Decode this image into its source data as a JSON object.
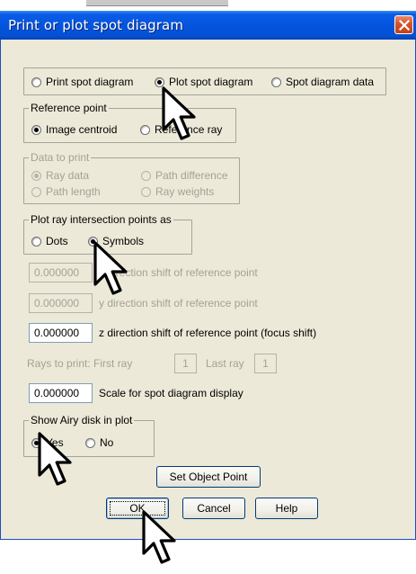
{
  "window": {
    "title": "Print or plot spot diagram"
  },
  "mode": {
    "options": [
      {
        "label": "Print spot diagram",
        "selected": false
      },
      {
        "label": "Plot spot diagram",
        "selected": true
      },
      {
        "label": "Spot diagram data",
        "selected": false
      }
    ]
  },
  "reference_point": {
    "legend": "Reference point",
    "options": [
      {
        "label": "Image centroid",
        "selected": true
      },
      {
        "label": "Reference ray",
        "selected": false
      }
    ]
  },
  "data_to_print": {
    "legend": "Data to print",
    "options": [
      {
        "label": "Ray data",
        "selected": true
      },
      {
        "label": "Path difference",
        "selected": false
      },
      {
        "label": "Path length",
        "selected": false
      },
      {
        "label": "Ray weights",
        "selected": false
      }
    ]
  },
  "plot_points": {
    "legend": "Plot ray intersection points as",
    "options": [
      {
        "label": "Dots",
        "selected": false
      },
      {
        "label": "Symbols",
        "selected": true
      }
    ]
  },
  "shifts": {
    "x": {
      "value": "0.000000",
      "label": "x direction shift of reference point"
    },
    "y": {
      "value": "0.000000",
      "label": "y direction shift of reference point"
    },
    "z": {
      "value": "0.000000",
      "label": "z direction shift of reference point (focus shift)"
    }
  },
  "rays": {
    "label": "Rays to print: First ray",
    "first_value": "1",
    "last_label": "Last ray",
    "last_value": "1"
  },
  "scale": {
    "value": "0.000000",
    "label": "Scale for spot diagram display"
  },
  "airy": {
    "legend": "Show Airy disk in plot",
    "options": [
      {
        "label": "Yes",
        "selected": true
      },
      {
        "label": "No",
        "selected": false
      }
    ]
  },
  "buttons": {
    "set_object_point": "Set Object Point",
    "ok": "OK",
    "cancel": "Cancel",
    "help": "Help"
  },
  "icons": {
    "close": "close-icon",
    "cursor": "mouse-pointer-icon"
  },
  "colors": {
    "titlebar": "#0454de",
    "dialog_bg": "#ece9d8",
    "close_button": "#d4532a",
    "disabled_text": "#a3a297"
  }
}
